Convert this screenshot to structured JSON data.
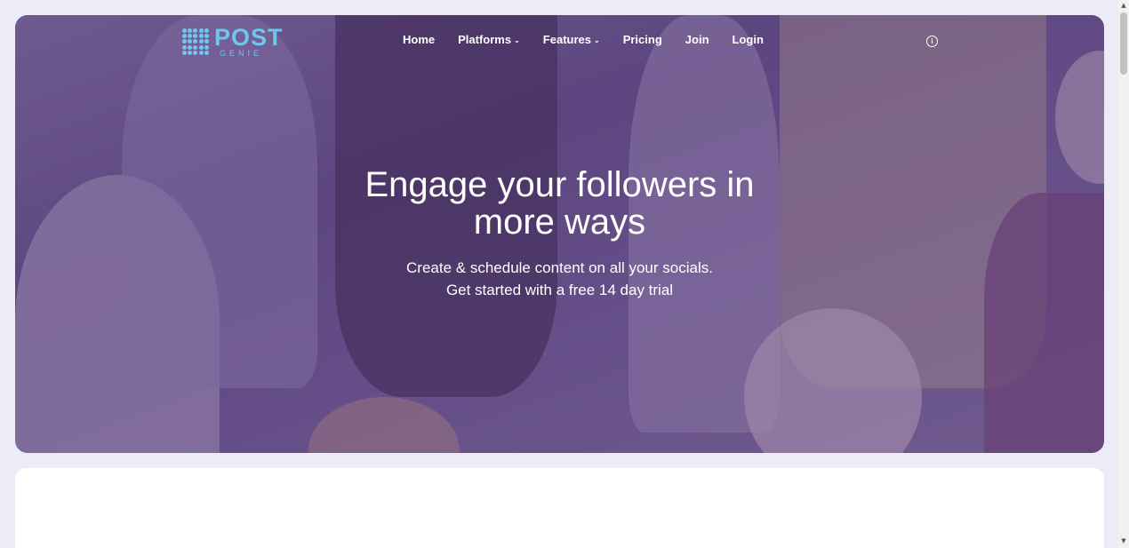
{
  "logo": {
    "post": "POST",
    "genie": "GENIE"
  },
  "nav": {
    "home": "Home",
    "platforms": "Platforms",
    "features": "Features",
    "pricing": "Pricing",
    "join": "Join",
    "login": "Login"
  },
  "hero": {
    "title_line1": "Engage your followers in",
    "title_line2": "more ways",
    "sub_line1": "Create & schedule content on all your socials.",
    "sub_line2": "Get started with a free 14 day trial"
  },
  "icons": {
    "chevron": "⌄",
    "info": "i",
    "scroll_up": "▲",
    "scroll_down": "▼"
  },
  "colors": {
    "brand": "#6fc6ee",
    "overlay": "#5c3e8c",
    "page_bg": "#ecebf7"
  }
}
